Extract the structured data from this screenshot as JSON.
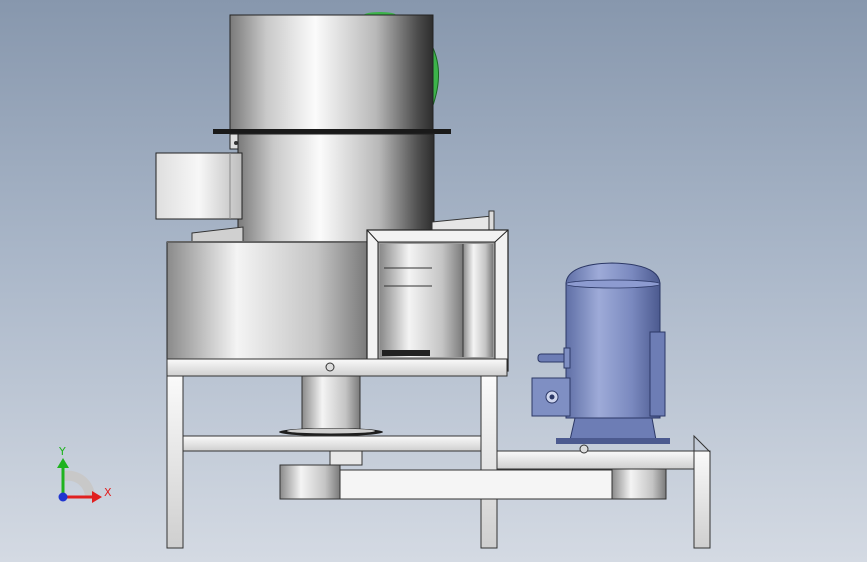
{
  "viewport": {
    "background_top": "#8797ad",
    "background_bottom": "#d4dae3"
  },
  "triad": {
    "y_label": "Y",
    "x_label": "X",
    "y_color": "#1fb31f",
    "x_color": "#e02020",
    "z_color": "#2036d0"
  },
  "model": {
    "metal_light": "#f4f4f4",
    "metal_dark": "#6e6e6e",
    "motor_color": "#7f8fc3",
    "fan_color": "#3cb34a"
  }
}
